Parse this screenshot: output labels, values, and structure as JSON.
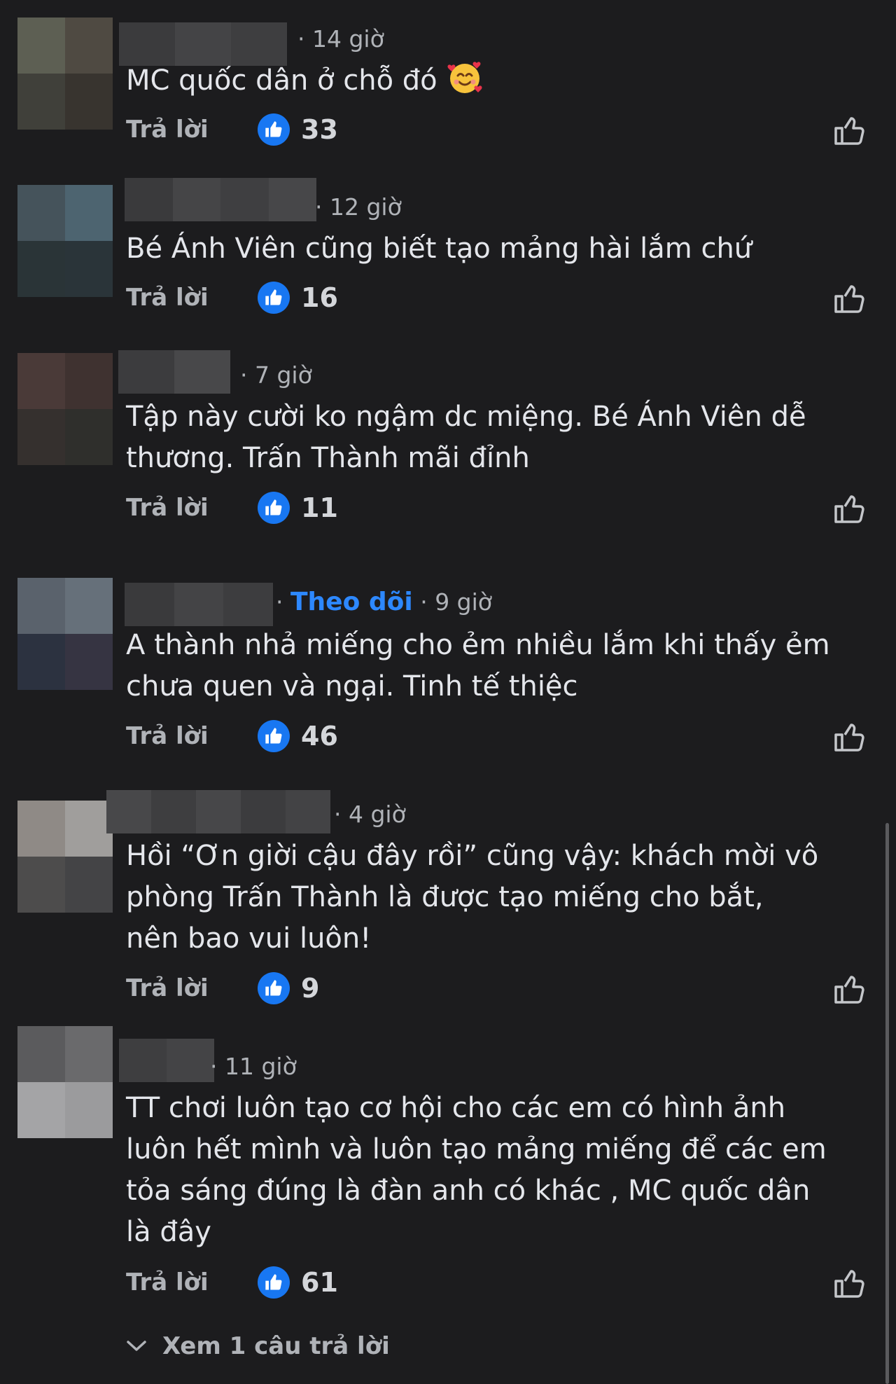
{
  "comments": [
    {
      "time": "· 14 giờ",
      "lines": [
        "MC quốc dân ở chỗ đó"
      ],
      "emoji": "smiling-face-with-hearts",
      "reply_label": "Trả lời",
      "likes": "33"
    },
    {
      "time": "· 12 giờ",
      "lines": [
        "Bé Ánh Viên cũng biết tạo mảng hài lắm chứ"
      ],
      "reply_label": "Trả lời",
      "likes": "16"
    },
    {
      "time": "· 7 giờ",
      "lines": [
        "Tập này cười ko ngậm dc miệng. Bé Ánh Viên dễ",
        "thương. Trấn Thành mãi đỉnh"
      ],
      "reply_label": "Trả lời",
      "likes": "11"
    },
    {
      "follow_prefix": "·",
      "follow_label": "Theo dõi",
      "time": "· 9 giờ",
      "lines": [
        "A thành nhả miếng cho ẻm nhiều lắm khi thấy ẻm",
        "chưa quen và ngại. Tinh tế thiệc"
      ],
      "reply_label": "Trả lời",
      "likes": "46"
    },
    {
      "time": "· 4 giờ",
      "lines": [
        "Hồi “Ơn giời cậu đây rồi” cũng vậy: khách mời vô",
        "phòng Trấn Thành là được tạo miếng cho bắt,",
        "nên bao vui luôn!"
      ],
      "reply_label": "Trả lời",
      "likes": "9"
    },
    {
      "time": "· 11 giờ",
      "lines": [
        "TT chơi luôn tạo cơ hội cho các em có hình ảnh",
        "luôn hết mình và luôn tạo mảng miếng để các em",
        "tỏa sáng đúng là đàn anh có khác , MC quốc dân",
        "là đây"
      ],
      "reply_label": "Trả lời",
      "likes": "61"
    }
  ],
  "view_replies_label": "Xem 1 câu trả lời",
  "colors": {
    "background": "#1c1c1e",
    "accent": "#1877f2",
    "follow": "#2d88ff",
    "muted_text": "#b0b3b8",
    "text": "#e4e6eb"
  }
}
